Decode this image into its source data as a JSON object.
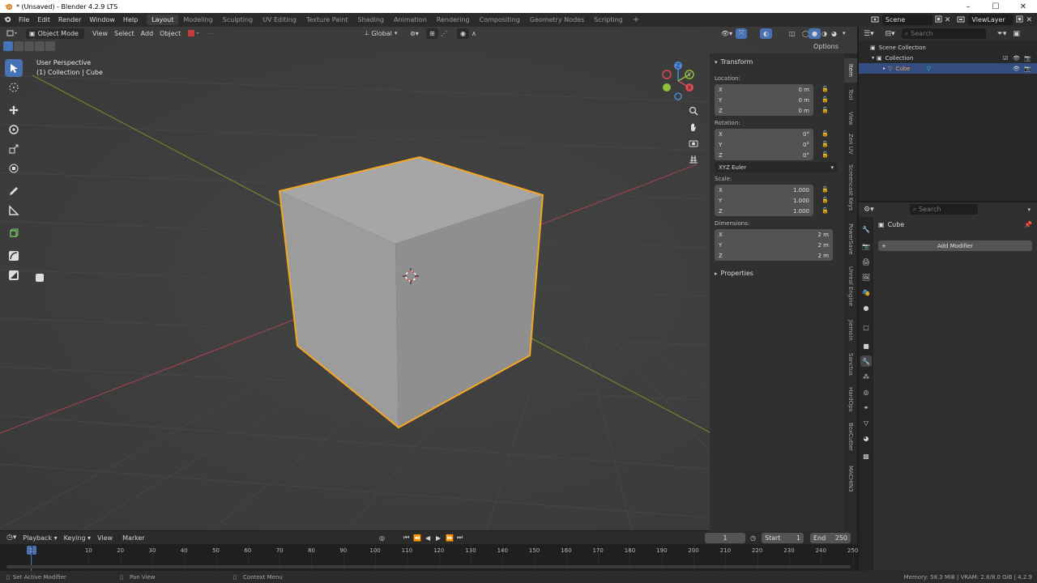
{
  "window": {
    "title": "* (Unsaved) - Blender 4.2.9 LTS",
    "controls": [
      "–",
      "☐",
      "✕"
    ]
  },
  "menu": [
    "File",
    "Edit",
    "Render",
    "Window",
    "Help"
  ],
  "workspaces": [
    {
      "label": "Layout",
      "active": true
    },
    {
      "label": "Modeling"
    },
    {
      "label": "Sculpting"
    },
    {
      "label": "UV Editing"
    },
    {
      "label": "Texture Paint"
    },
    {
      "label": "Shading"
    },
    {
      "label": "Animation"
    },
    {
      "label": "Rendering"
    },
    {
      "label": "Compositing"
    },
    {
      "label": "Geometry Nodes"
    },
    {
      "label": "Scripting"
    }
  ],
  "add_workspace": "+",
  "scene": {
    "label": "Scene",
    "view_layer": "ViewLayer"
  },
  "viewport": {
    "mode": "Object Mode",
    "menus": [
      "View",
      "Select",
      "Add",
      "Object"
    ],
    "orientation": "Global",
    "options": "Options",
    "overlay_title": "User Perspective",
    "overlay_subtitle": "(1) Collection | Cube",
    "gizmo": {
      "x": "X",
      "y": "Y",
      "z": "Z"
    }
  },
  "npanel": {
    "transform_title": "Transform",
    "location_label": "Location:",
    "location": [
      {
        "axis": "X",
        "value": "0 m"
      },
      {
        "axis": "Y",
        "value": "0 m"
      },
      {
        "axis": "Z",
        "value": "0 m"
      }
    ],
    "rotation_label": "Rotation:",
    "rotation": [
      {
        "axis": "X",
        "value": "0°"
      },
      {
        "axis": "Y",
        "value": "0°"
      },
      {
        "axis": "Z",
        "value": "0°"
      }
    ],
    "rotation_mode": "XYZ Euler",
    "scale_label": "Scale:",
    "scale": [
      {
        "axis": "X",
        "value": "1.000"
      },
      {
        "axis": "Y",
        "value": "1.000"
      },
      {
        "axis": "Z",
        "value": "1.000"
      }
    ],
    "dimensions_label": "Dimensions:",
    "dimensions": [
      {
        "axis": "X",
        "value": "2 m"
      },
      {
        "axis": "Y",
        "value": "2 m"
      },
      {
        "axis": "Z",
        "value": "2 m"
      }
    ],
    "properties_title": "Properties"
  },
  "vtabs": [
    "Item",
    "Tool",
    "View",
    "Zen UV",
    "Screencast Keys",
    "PowerSave",
    "Unreal Engine",
    "Jiemoin",
    "Sanctus",
    "HardOps",
    "BoxCutter",
    "MACHIN3"
  ],
  "outliner": {
    "search_placeholder": "Search",
    "rows": [
      {
        "label": "Scene Collection"
      },
      {
        "label": "Collection"
      },
      {
        "label": "Cube"
      }
    ]
  },
  "properties": {
    "search_placeholder": "Search",
    "object_name": "Cube",
    "add_modifier": "Add Modifier"
  },
  "timeline": {
    "menus": [
      "Playback",
      "Keying",
      "View",
      "Marker"
    ],
    "current_frame": "1",
    "start_label": "Start",
    "start": "1",
    "end_label": "End",
    "end": "250",
    "ticks": [
      "1",
      "10",
      "20",
      "30",
      "40",
      "50",
      "60",
      "70",
      "80",
      "90",
      "100",
      "110",
      "120",
      "130",
      "140",
      "150",
      "160",
      "170",
      "180",
      "190",
      "200",
      "210",
      "220",
      "230",
      "240",
      "250"
    ]
  },
  "statusbar": {
    "left": "Set Active Modifier",
    "middle": "Pan View",
    "right": "Context Menu",
    "memory": "Memory: 58.3 MiB | VRAM: 2.8/8.0 GiB | 4.2.9"
  },
  "colors": {
    "accent": "#4772b3",
    "selection_outline": "#f5a623",
    "x_axis": "#d94a55",
    "y_axis": "#8fbf3a",
    "z_axis": "#4a8ad9"
  }
}
